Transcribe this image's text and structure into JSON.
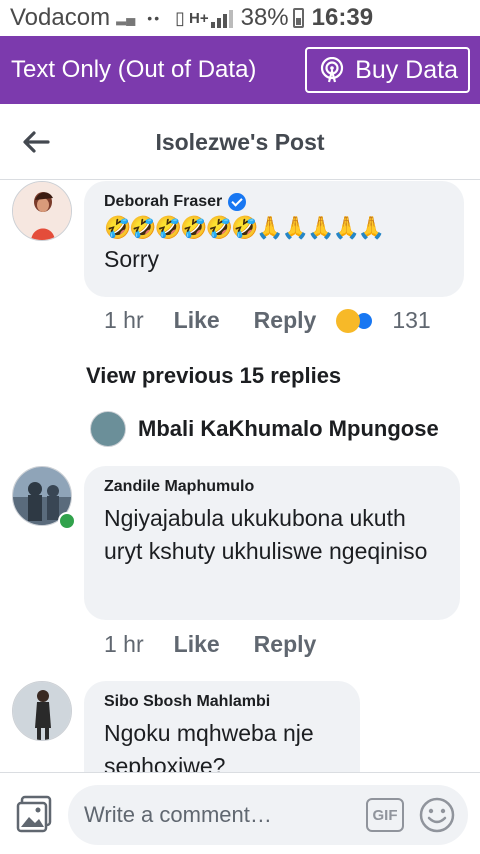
{
  "status_bar": {
    "carrier": "Vodacom",
    "network": "H+",
    "battery": "38%",
    "time": "16:39"
  },
  "data_banner": {
    "title": "Text Only (Out of Data)",
    "buy_label": "Buy Data"
  },
  "header": {
    "title": "Isolezwe's Post"
  },
  "comments": [
    {
      "author": "Deborah Fraser",
      "verified": true,
      "emojis": "🤣🤣🤣🤣🤣🤣🙏🙏🙏🙏🙏",
      "text": "Sorry",
      "time": "1 hr",
      "like": "Like",
      "reply": "Reply",
      "reaction_count": "131"
    },
    {
      "author": "Zandile Maphumulo",
      "text": "Ngiyajabula ukukubona ukuth uryt kshuty ukhuliswe ngeqiniso",
      "time": "1 hr",
      "like": "Like",
      "reply": "Reply",
      "online": true
    },
    {
      "author": "Sibo Sbosh Mahlambi",
      "text": "Ngoku mqhweba nje sephoxiwe?"
    }
  ],
  "view_previous": "View previous 15 replies",
  "reply_preview": {
    "name": "Mbali KaKhumalo Mpungose"
  },
  "composer": {
    "placeholder": "Write a comment…",
    "gif_label": "GIF"
  },
  "colors": {
    "banner": "#7c3aad",
    "bubble": "#f0f2f5",
    "online": "#31a24c",
    "verified": "#1877f2"
  }
}
